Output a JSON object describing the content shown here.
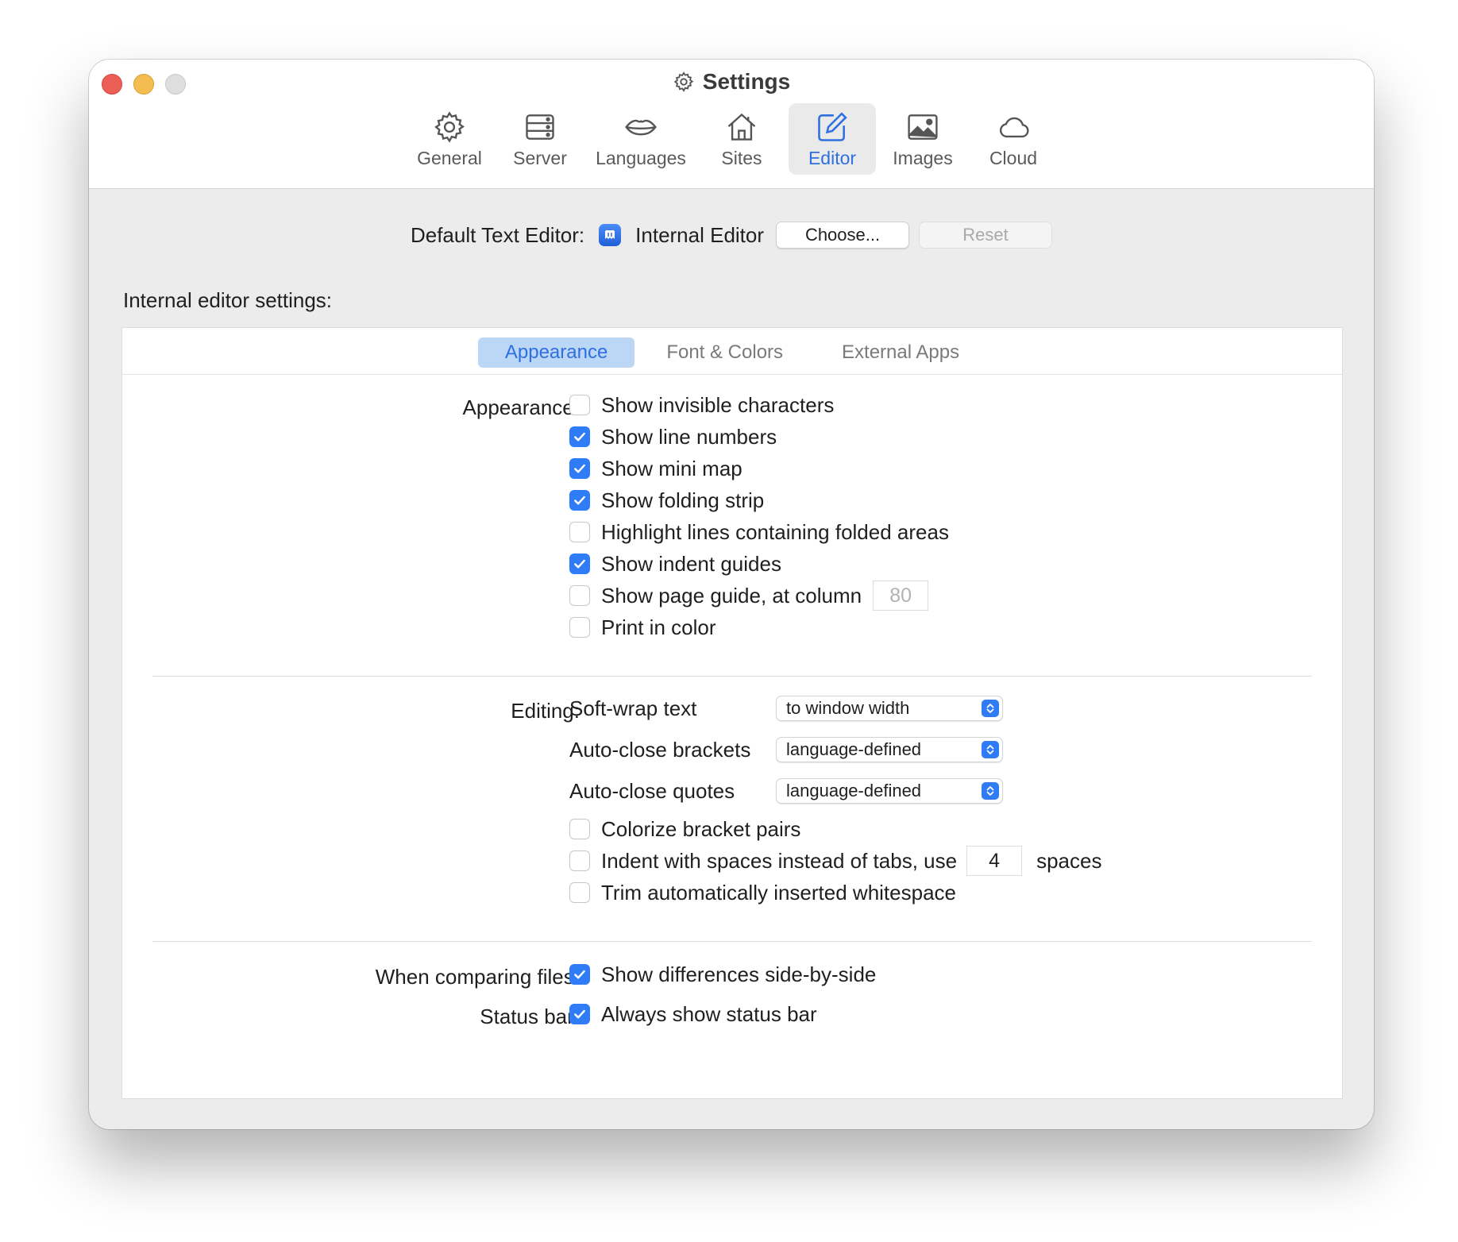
{
  "window": {
    "title": "Settings",
    "toolbar": [
      {
        "label": "General",
        "icon": "gear-icon",
        "active": false
      },
      {
        "label": "Server",
        "icon": "server-icon",
        "active": false
      },
      {
        "label": "Languages",
        "icon": "lips-icon",
        "active": false
      },
      {
        "label": "Sites",
        "icon": "house-icon",
        "active": false
      },
      {
        "label": "Editor",
        "icon": "edit-icon",
        "active": true
      },
      {
        "label": "Images",
        "icon": "image-icon",
        "active": false
      },
      {
        "label": "Cloud",
        "icon": "cloud-icon",
        "active": false
      }
    ]
  },
  "default_editor": {
    "label": "Default Text Editor:",
    "app_name": "Internal Editor",
    "choose_label": "Choose...",
    "reset_label": "Reset"
  },
  "section_label": "Internal editor settings:",
  "tabs": [
    "Appearance",
    "Font & Colors",
    "External Apps"
  ],
  "active_tab": "Appearance",
  "appearance": {
    "label": "Appearance:",
    "options": [
      {
        "text": "Show invisible characters",
        "checked": false
      },
      {
        "text": "Show line numbers",
        "checked": true
      },
      {
        "text": "Show mini map",
        "checked": true
      },
      {
        "text": "Show folding strip",
        "checked": true
      },
      {
        "text": "Highlight lines containing folded areas",
        "checked": false
      },
      {
        "text": "Show indent guides",
        "checked": true
      },
      {
        "text": "Show page guide, at column",
        "checked": false
      },
      {
        "text": "Print in color",
        "checked": false
      }
    ],
    "page_guide_column": "80"
  },
  "editing": {
    "label": "Editing:",
    "selects": [
      {
        "label": "Soft-wrap text",
        "value": "to window width"
      },
      {
        "label": "Auto-close brackets",
        "value": "language-defined"
      },
      {
        "label": "Auto-close quotes",
        "value": "language-defined"
      }
    ],
    "options": [
      {
        "text": "Colorize bracket pairs",
        "checked": false
      },
      {
        "text": "Indent with spaces instead of tabs, use",
        "checked": false
      },
      {
        "text": "Trim automatically inserted whitespace",
        "checked": false
      }
    ],
    "indent_spaces": "4",
    "spaces_suffix": "spaces"
  },
  "comparing": {
    "label": "When comparing files:",
    "option": {
      "text": "Show differences side-by-side",
      "checked": true
    }
  },
  "status_bar": {
    "label": "Status bar:",
    "option": {
      "text": "Always show status bar",
      "checked": true
    }
  },
  "colors": {
    "accent": "#2f7cf6",
    "active_tab_bg": "#bcd6f5",
    "close": "#ec5f57",
    "minimize": "#f4bd4f"
  }
}
